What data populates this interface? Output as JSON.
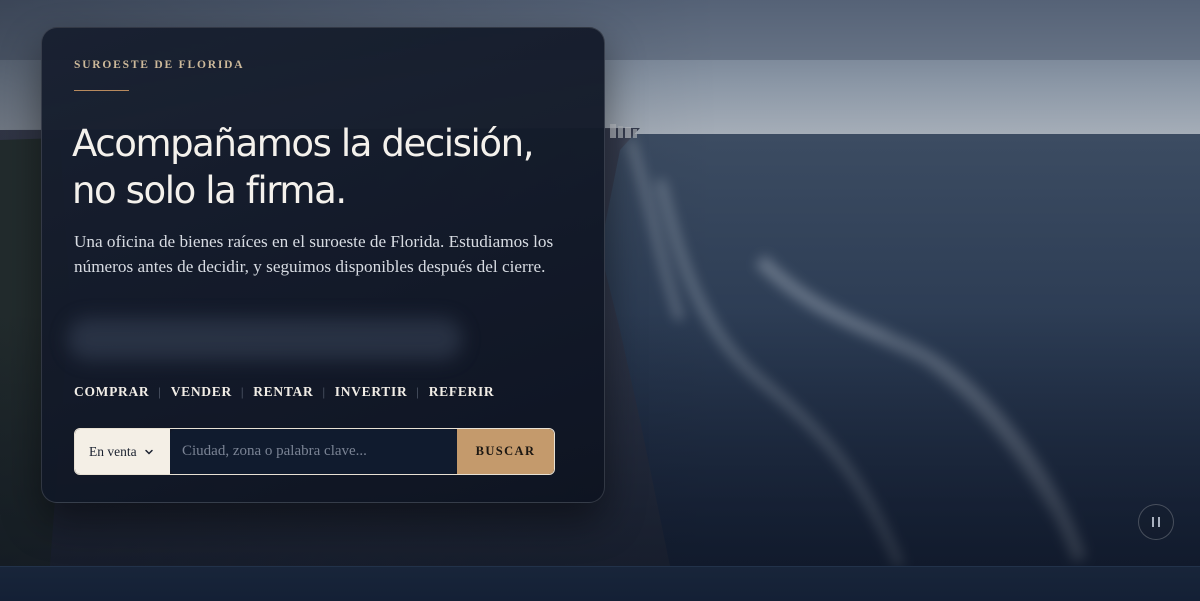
{
  "hero": {
    "eyebrow": "SUROESTE DE FLORIDA",
    "headline": "Acompañamos la decisión, no solo la firma.",
    "intro": "Una oficina de bienes raíces en el suroeste de Florida. Estudiamos los números antes de decidir, y seguimos disponibles después del cierre."
  },
  "nav": {
    "links": [
      "COMPRAR",
      "VENDER",
      "RENTAR",
      "INVERTIR",
      "REFERIR"
    ]
  },
  "search": {
    "type_label": "En venta",
    "placeholder": "Ciudad, zona o palabra clave...",
    "button_label": "BUSCAR"
  },
  "video": {
    "control_icon": "pause-icon",
    "state": "playing"
  },
  "colors": {
    "accent": "#c49a6c",
    "card_bg": "#141c2c",
    "text": "#f4f1ec",
    "eyebrow": "#cdb99a"
  }
}
